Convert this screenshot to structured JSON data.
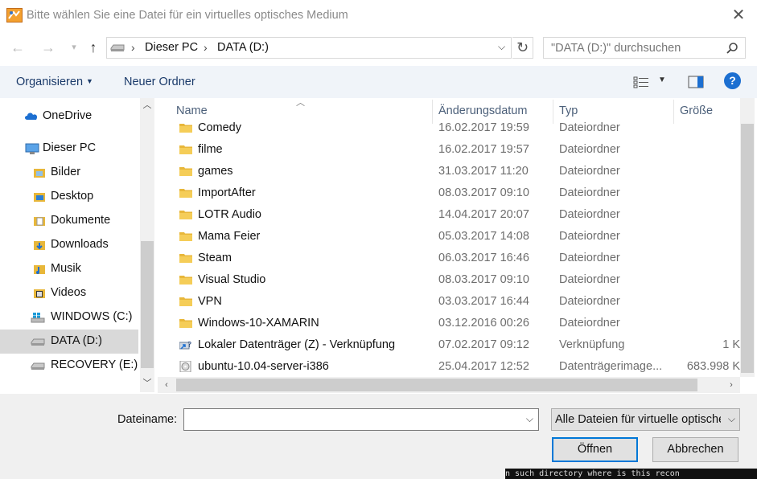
{
  "window": {
    "title": "Bitte wählen Sie eine Datei für ein virtuelles optisches Medium",
    "app_icon": "virtualbox-icon",
    "close_icon": "close-icon"
  },
  "navigation": {
    "back_icon": "arrow-left-icon",
    "forward_icon": "arrow-right-icon",
    "recent_icon": "chevron-down-icon",
    "up_icon": "arrow-up-icon",
    "breadcrumb": [
      "Dieser PC",
      "DATA (D:)"
    ],
    "refresh_icon": "refresh-icon",
    "search_placeholder": "\"DATA (D:)\" durchsuchen"
  },
  "toolbar": {
    "organize_label": "Organisieren",
    "new_folder_label": "Neuer Ordner",
    "help_label": "?"
  },
  "sidebar": {
    "items": [
      {
        "label": "OneDrive",
        "icon": "cloud-icon"
      },
      {
        "label": "Dieser PC",
        "icon": "computer-icon"
      },
      {
        "label": "Bilder",
        "icon": "pictures-folder-icon"
      },
      {
        "label": "Desktop",
        "icon": "desktop-folder-icon"
      },
      {
        "label": "Dokumente",
        "icon": "documents-folder-icon"
      },
      {
        "label": "Downloads",
        "icon": "downloads-folder-icon"
      },
      {
        "label": "Musik",
        "icon": "music-folder-icon"
      },
      {
        "label": "Videos",
        "icon": "videos-folder-icon"
      },
      {
        "label": "WINDOWS (C:)",
        "icon": "windows-drive-icon"
      },
      {
        "label": "DATA (D:)",
        "icon": "drive-icon",
        "selected": true
      },
      {
        "label": "RECOVERY (E:)",
        "icon": "drive-icon"
      }
    ]
  },
  "filelist": {
    "columns": [
      "Name",
      "Änderungsdatum",
      "Typ",
      "Größe"
    ],
    "rows": [
      {
        "name": "Comedy",
        "date": "16.02.2017 19:59",
        "type": "Dateiordner",
        "size": "",
        "icon": "folder-icon"
      },
      {
        "name": "filme",
        "date": "16.02.2017 19:57",
        "type": "Dateiordner",
        "size": "",
        "icon": "folder-icon"
      },
      {
        "name": "games",
        "date": "31.03.2017 11:20",
        "type": "Dateiordner",
        "size": "",
        "icon": "folder-icon"
      },
      {
        "name": "ImportAfter",
        "date": "08.03.2017 09:10",
        "type": "Dateiordner",
        "size": "",
        "icon": "folder-icon"
      },
      {
        "name": "LOTR Audio",
        "date": "14.04.2017 20:07",
        "type": "Dateiordner",
        "size": "",
        "icon": "folder-icon"
      },
      {
        "name": "Mama Feier",
        "date": "05.03.2017 14:08",
        "type": "Dateiordner",
        "size": "",
        "icon": "folder-icon"
      },
      {
        "name": "Steam",
        "date": "06.03.2017 16:46",
        "type": "Dateiordner",
        "size": "",
        "icon": "folder-icon"
      },
      {
        "name": "Visual Studio",
        "date": "08.03.2017 09:10",
        "type": "Dateiordner",
        "size": "",
        "icon": "folder-icon"
      },
      {
        "name": "VPN",
        "date": "03.03.2017 16:44",
        "type": "Dateiordner",
        "size": "",
        "icon": "folder-icon"
      },
      {
        "name": "Windows-10-XAMARIN",
        "date": "03.12.2016 00:26",
        "type": "Dateiordner",
        "size": "",
        "icon": "folder-icon"
      },
      {
        "name": "Lokaler Datenträger (Z) - Verknüpfung",
        "date": "07.02.2017 09:12",
        "type": "Verknüpfung",
        "size": "1 K",
        "icon": "shortcut-icon"
      },
      {
        "name": "ubuntu-10.04-server-i386",
        "date": "25.04.2017 12:52",
        "type": "Datenträgerimage...",
        "size": "683.998 K",
        "icon": "disc-image-icon"
      }
    ]
  },
  "footer": {
    "filename_label": "Dateiname:",
    "filename_value": "",
    "filter_value": "Alle Dateien für virtuelle optischen",
    "open_label": "Öffnen",
    "cancel_label": "Abbrechen"
  },
  "background": {
    "terminal_text": "n such directory where is this recon"
  },
  "colors": {
    "accent": "#0078d7",
    "folder": "#e8b73a",
    "selected_row": "#d9d9d9",
    "toolbar_bg": "#f0f4f9"
  }
}
